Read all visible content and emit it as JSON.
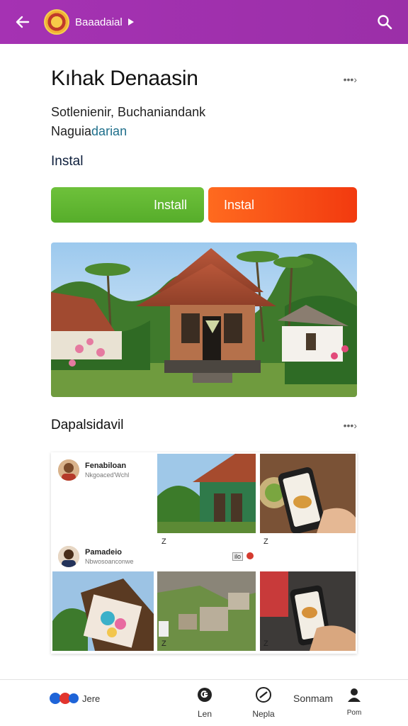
{
  "header": {
    "title": "Baaadaial",
    "back_icon": "arrow-left-icon",
    "search_icon": "search-icon",
    "bg_color": "#a532b3"
  },
  "app": {
    "name": "Kıhak Denaasin",
    "subtitle_line1": "Sotlenienir, Buchaniandank",
    "subtitle_line2_a": "Naguia",
    "subtitle_line2_b": "darian",
    "install_label": "Instal"
  },
  "buttons": {
    "primary": "Install",
    "secondary": "Instal",
    "primary_color": "#5cb531",
    "secondary_color": "#f7491a"
  },
  "gallery": {
    "section_title": "Dapalsidavil",
    "posts": [
      {
        "name": "Fenabiloan",
        "sub": "Nkgoaced'Wchl"
      },
      {
        "name": "Pamadeio",
        "sub": "Nbwosoanconwe"
      }
    ],
    "badges": {
      "mark": "Z",
      "tag": "ilo"
    }
  },
  "bottom_nav": [
    {
      "label": "Jere",
      "icon": "social-icon"
    },
    {
      "label": "Len",
      "icon": "g-icon"
    },
    {
      "label": "Nepla",
      "icon": "link-icon"
    },
    {
      "label": "Sonmam",
      "icon": ""
    },
    {
      "label": "Pom",
      "icon": "user-icon"
    }
  ]
}
